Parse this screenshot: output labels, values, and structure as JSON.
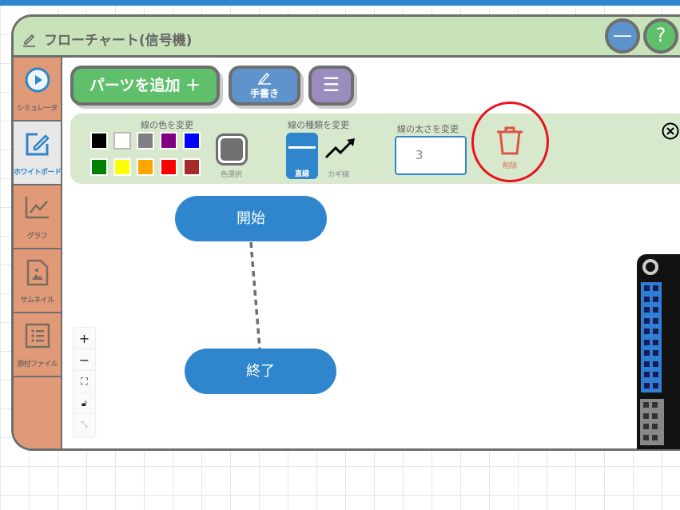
{
  "window": {
    "title": "フローチャート(信号機)",
    "minimize_icon": "minus",
    "help_label": "?"
  },
  "sidebar": {
    "items": [
      {
        "label": "シミュレータ",
        "icon": "play-circle"
      },
      {
        "label": "ホワイトボード",
        "icon": "edit-square",
        "active": true
      },
      {
        "label": "グラフ",
        "icon": "line-chart"
      },
      {
        "label": "サムネイル",
        "icon": "image-file"
      },
      {
        "label": "添付ファイル",
        "icon": "list"
      }
    ]
  },
  "toolbar": {
    "add_parts": "パーツを追加 ＋",
    "handwrite": "手書き",
    "menu_icon": "hamburger"
  },
  "panel": {
    "line_color_title": "線の色を変更",
    "colors": [
      "#000000",
      "#ffffff",
      "#808080",
      "#800080",
      "#0000ff",
      "#008000",
      "#ffff00",
      "#ffa500",
      "#ff0000",
      "#a52a2a"
    ],
    "color_picker_label": "色選択",
    "color_picker_value": "#707070",
    "line_type_title": "線の種類を変更",
    "line_types": [
      "直線",
      "カギ線"
    ],
    "selected_line_type": "直線",
    "line_width_title": "線の太さを変更",
    "line_width": "3",
    "delete_label": "削除"
  },
  "nodes": [
    {
      "label": "開始"
    },
    {
      "label": "終了"
    }
  ],
  "zoom_controls": [
    "+",
    "−",
    "fit",
    "lock",
    "collapse"
  ],
  "accent": "#2f86cc"
}
